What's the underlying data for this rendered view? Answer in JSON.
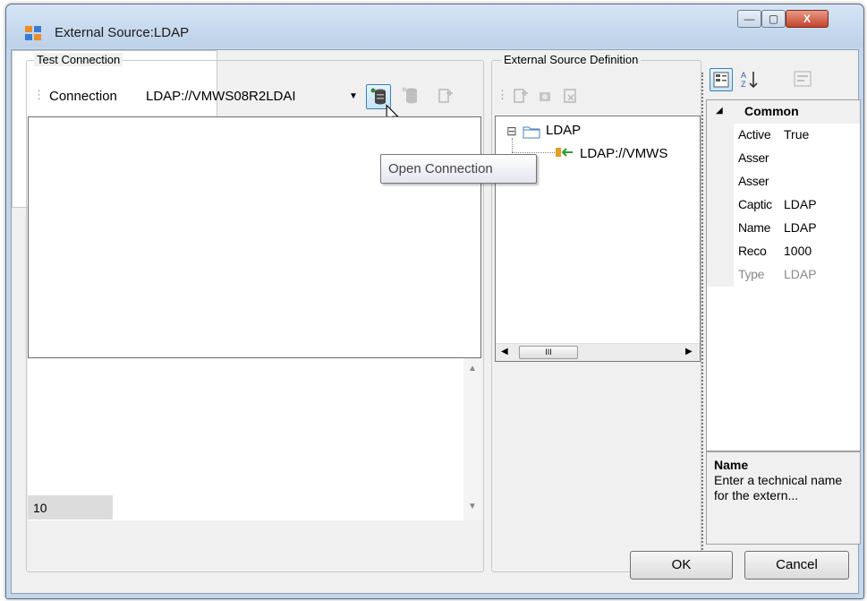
{
  "window": {
    "title": "External Source:LDAP",
    "controls": {
      "minimize": "—",
      "maximize": "▢",
      "close": "X"
    }
  },
  "test_connection": {
    "group_label": "Test Connection",
    "connection_label": "Connection",
    "connection_value": "LDAP://VMWS08R2LDAI",
    "row_number": "10"
  },
  "external_source_definition": {
    "group_label": "External Source Definition",
    "tree": [
      {
        "label": "LDAP",
        "icon": "folder-icon",
        "expander": "⊟"
      },
      {
        "label": "LDAP://VMWS",
        "icon": "connection-icon"
      }
    ],
    "hscroll_thumb": "III"
  },
  "properties": {
    "category": "Common",
    "rows": [
      {
        "name": "Active",
        "value": "True",
        "disabled": false
      },
      {
        "name": "Asser",
        "value": "",
        "disabled": false
      },
      {
        "name": "Asser",
        "value": "",
        "disabled": false
      },
      {
        "name": "Captic",
        "value": "LDAP",
        "disabled": false
      },
      {
        "name": "Name",
        "value": "LDAP",
        "disabled": false
      },
      {
        "name": "Reco",
        "value": "1000",
        "disabled": false
      },
      {
        "name": "Type",
        "value": "LDAP",
        "disabled": true
      }
    ],
    "description_title": "Name",
    "description_text": "Enter a technical name for the extern..."
  },
  "tooltip": "Open Connection",
  "buttons": {
    "ok": "OK",
    "cancel": "Cancel"
  },
  "colors": {
    "titlebar": "#c4d7ea",
    "dialog_bg": "#f0f0f0",
    "close_button": "#c4442b",
    "tooltip_text": "#444444"
  }
}
